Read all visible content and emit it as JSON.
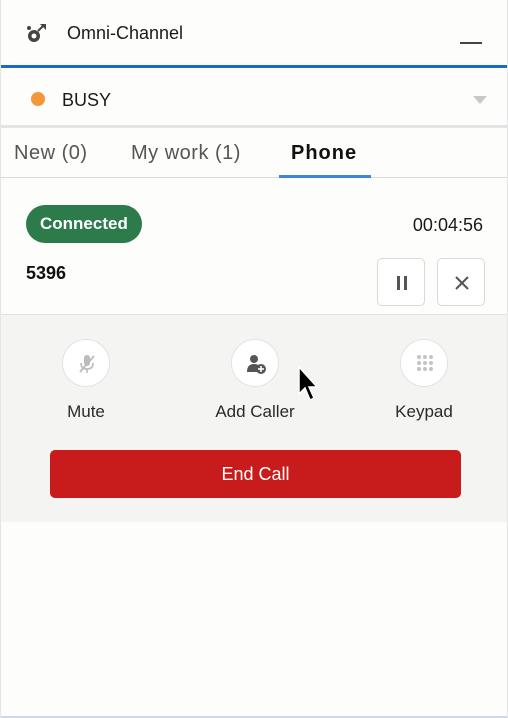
{
  "header": {
    "title": "Omni-Channel",
    "app_icon": "omni-channel-icon",
    "minimize_icon": "minimize-icon"
  },
  "status": {
    "label": "BUSY",
    "color": "#f4973a",
    "dropdown_icon": "chevron-down-icon"
  },
  "tabs": [
    {
      "label": "New (0)",
      "active": false
    },
    {
      "label": "My work (1)",
      "active": false
    },
    {
      "label": "Phone",
      "active": true
    }
  ],
  "call": {
    "status_badge": "Connected",
    "badge_color": "#2d7a4b",
    "timer": "00:04:56",
    "caller_number": "5396",
    "pause_icon": "pause-icon",
    "close_icon": "close-icon"
  },
  "actions": [
    {
      "label": "Mute",
      "icon": "mute-microphone-icon"
    },
    {
      "label": "Add Caller",
      "icon": "add-caller-icon"
    },
    {
      "label": "Keypad",
      "icon": "keypad-icon"
    }
  ],
  "end_call": {
    "label": "End Call",
    "color": "#c81b1b"
  },
  "accent_color": "#1b6bc4"
}
